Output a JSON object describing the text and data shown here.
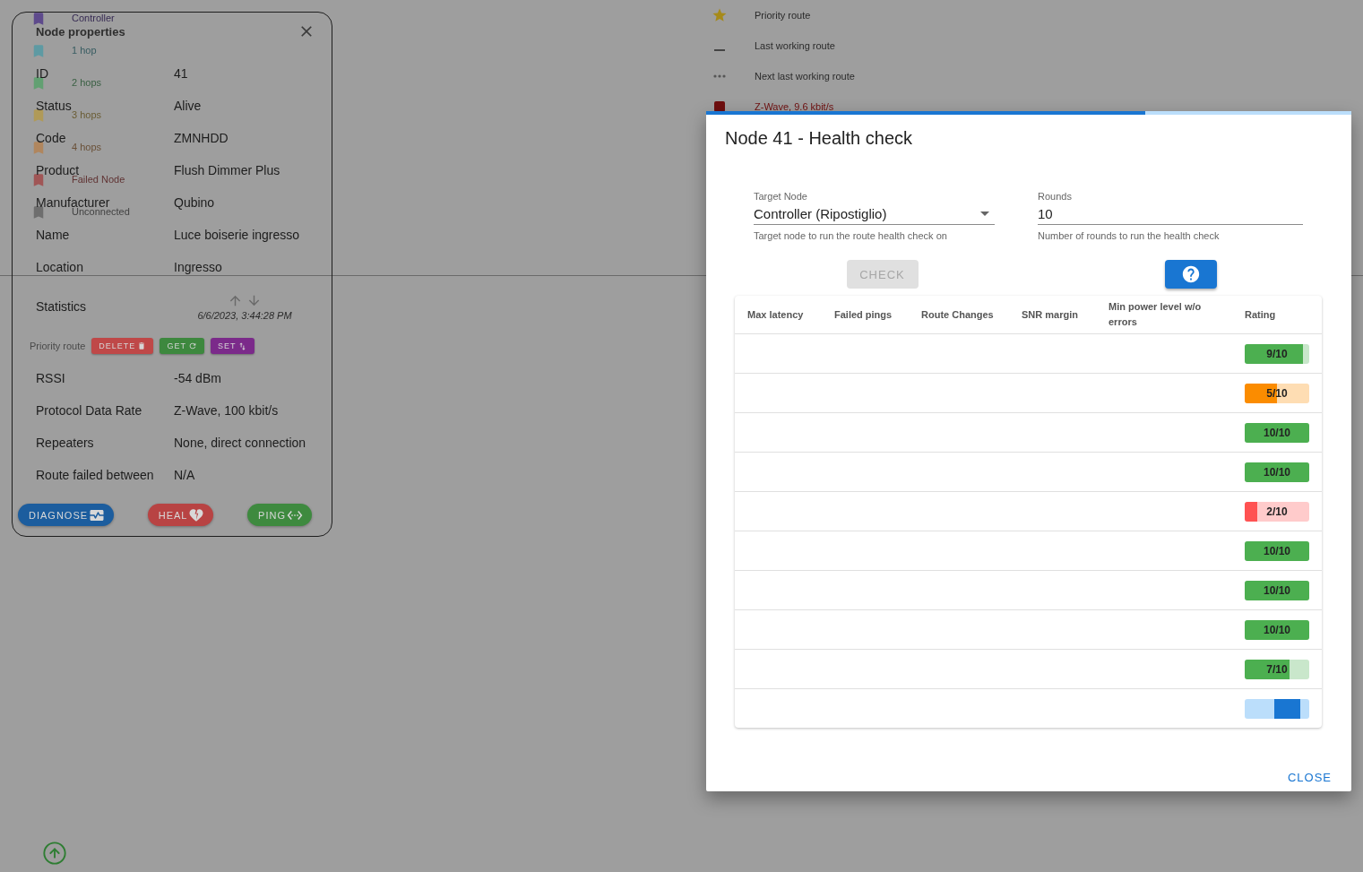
{
  "node_legend": [
    {
      "label": "Controller",
      "color": "#5e4a8c"
    },
    {
      "label": "1 hop",
      "color": "#5e9aa3"
    },
    {
      "label": "2 hops",
      "color": "#62a072"
    },
    {
      "label": "3 hops",
      "color": "#b09a58"
    },
    {
      "label": "4 hops",
      "color": "#b0865e"
    },
    {
      "label": "Failed Node",
      "color": "#a05656"
    },
    {
      "label": "Unconnected",
      "color": "#6e6e6e"
    }
  ],
  "route_legend": [
    {
      "kind": "star",
      "label": "Priority route"
    },
    {
      "kind": "dash",
      "label": "Last working route"
    },
    {
      "kind": "dots",
      "label": "Next last working route"
    },
    {
      "kind": "square",
      "label": "Z-Wave, 9.6 kbit/s"
    }
  ],
  "node_properties": {
    "title": "Node properties",
    "rows": [
      {
        "kind": "text",
        "label": "ID",
        "value": "41"
      },
      {
        "kind": "text",
        "label": "Status",
        "value": "Alive"
      },
      {
        "kind": "text",
        "label": "Code",
        "value": "ZMNHDD"
      },
      {
        "kind": "text",
        "label": "Product",
        "value": "Flush Dimmer Plus"
      },
      {
        "kind": "text",
        "label": "Manufacturer",
        "value": "Qubino"
      },
      {
        "kind": "text",
        "label": "Name",
        "value": "Luce boiserie ingresso"
      },
      {
        "kind": "text",
        "label": "Location",
        "value": "Ingresso"
      },
      {
        "kind": "statistics",
        "label": "Statistics",
        "timestamp": "6/6/2023, 3:44:28 PM"
      },
      {
        "kind": "actions",
        "label": "Priority route",
        "buttons": [
          {
            "kind": "delete",
            "label": "DELETE"
          },
          {
            "kind": "get",
            "label": "GET"
          },
          {
            "kind": "set",
            "label": "SET"
          }
        ]
      },
      {
        "kind": "text",
        "label": "RSSI",
        "value": "-54 dBm"
      },
      {
        "kind": "text",
        "label": "Protocol Data Rate",
        "value": "Z-Wave, 100 kbit/s"
      },
      {
        "kind": "text",
        "label": "Repeaters",
        "value": "None, direct connection"
      },
      {
        "kind": "text",
        "label": "Route failed between",
        "value": "N/A"
      }
    ],
    "buttons": [
      {
        "kind": "diagnose",
        "label": "DIAGNOSE"
      },
      {
        "kind": "heal",
        "label": "HEAL"
      },
      {
        "kind": "ping",
        "label": "PING"
      }
    ]
  },
  "dialog": {
    "title": "Node 41 - Health check",
    "progress": {
      "level": 0.68
    },
    "fields": [
      {
        "kind": "select",
        "label": "Target Node",
        "value": "Controller (Ripostiglio)",
        "helper": "Target node to run the route health check on"
      },
      {
        "kind": "number",
        "label": "Rounds",
        "value": "10",
        "helper": "Number of rounds to run the health check"
      }
    ],
    "check_button": {
      "label": "CHECK",
      "disabled": true
    },
    "table": {
      "columns": [
        "Max latency",
        "Failed pings",
        "Route Changes",
        "SNR margin",
        "Min power level w/o errors",
        "Rating"
      ],
      "rows": [
        {
          "kind": "rating",
          "rating": "9/10",
          "level": 0.9,
          "color": "#4caf50"
        },
        {
          "kind": "rating",
          "rating": "5/10",
          "level": 0.5,
          "color": "#fb8c00"
        },
        {
          "kind": "rating",
          "rating": "10/10",
          "level": 1,
          "color": "#4caf50"
        },
        {
          "kind": "rating",
          "rating": "10/10",
          "level": 1,
          "color": "#4caf50"
        },
        {
          "kind": "rating",
          "rating": "2/10",
          "level": 0.2,
          "color": "#ff5252"
        },
        {
          "kind": "rating",
          "rating": "10/10",
          "level": 1,
          "color": "#4caf50"
        },
        {
          "kind": "rating",
          "rating": "10/10",
          "level": 1,
          "color": "#4caf50"
        },
        {
          "kind": "rating",
          "rating": "10/10",
          "level": 1,
          "color": "#4caf50"
        },
        {
          "kind": "rating",
          "rating": "7/10",
          "level": 0.7,
          "color": "#4caf50"
        },
        {
          "kind": "pending"
        }
      ]
    },
    "close_button": "CLOSE"
  }
}
